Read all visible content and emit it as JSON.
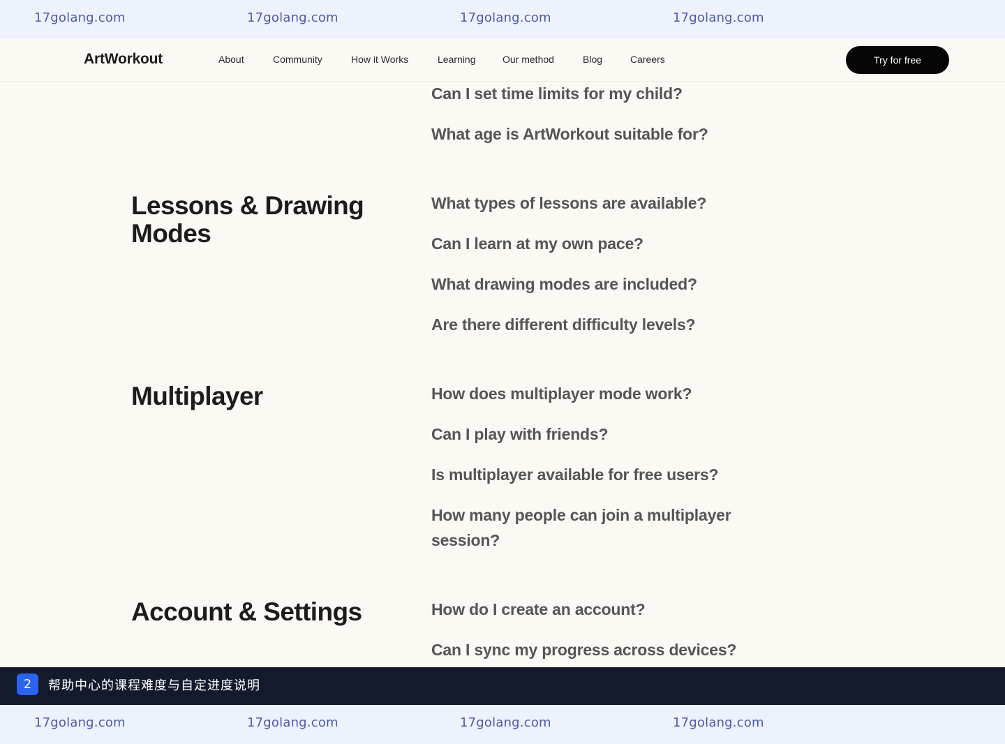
{
  "watermark": {
    "top": [
      "17golang.com",
      "17golang.com",
      "17golang.com",
      "17golang.com"
    ],
    "bottom": [
      "17golang.com",
      "17golang.com",
      "17golang.com",
      "17golang.com"
    ]
  },
  "header": {
    "logo": "ArtWorkout",
    "nav": [
      "About",
      "Community",
      "How it Works",
      "Learning",
      "Our method",
      "Blog",
      "Careers"
    ],
    "cta_label": "Try for free"
  },
  "faq": {
    "prev_questions": [
      "Can I set time limits for my child?",
      "What age is ArtWorkout suitable for?"
    ],
    "sections": [
      {
        "title": "Lessons & Drawing Modes",
        "questions": [
          "What types of lessons are available?",
          "Can I learn at my own pace?",
          "What drawing modes are included?",
          "Are there different difficulty levels?"
        ]
      },
      {
        "title": "Multiplayer",
        "questions": [
          "How does multiplayer mode work?",
          "Can I play with friends?",
          "Is multiplayer available for free users?",
          "How many people can join a multiplayer session?"
        ]
      },
      {
        "title": "Account & Settings",
        "questions": [
          "How do I create an account?",
          "Can I sync my progress across devices?"
        ]
      }
    ]
  },
  "caption": {
    "index": "2",
    "text": "帮助中心的课程难度与自定进度说明"
  },
  "colors": {
    "page_bg": "#fcf8f4",
    "watermark_bg": "#edf2fd",
    "cta_bg": "#050505",
    "caption_bg": "#131a2b",
    "badge_bg": "#2b63f3"
  }
}
